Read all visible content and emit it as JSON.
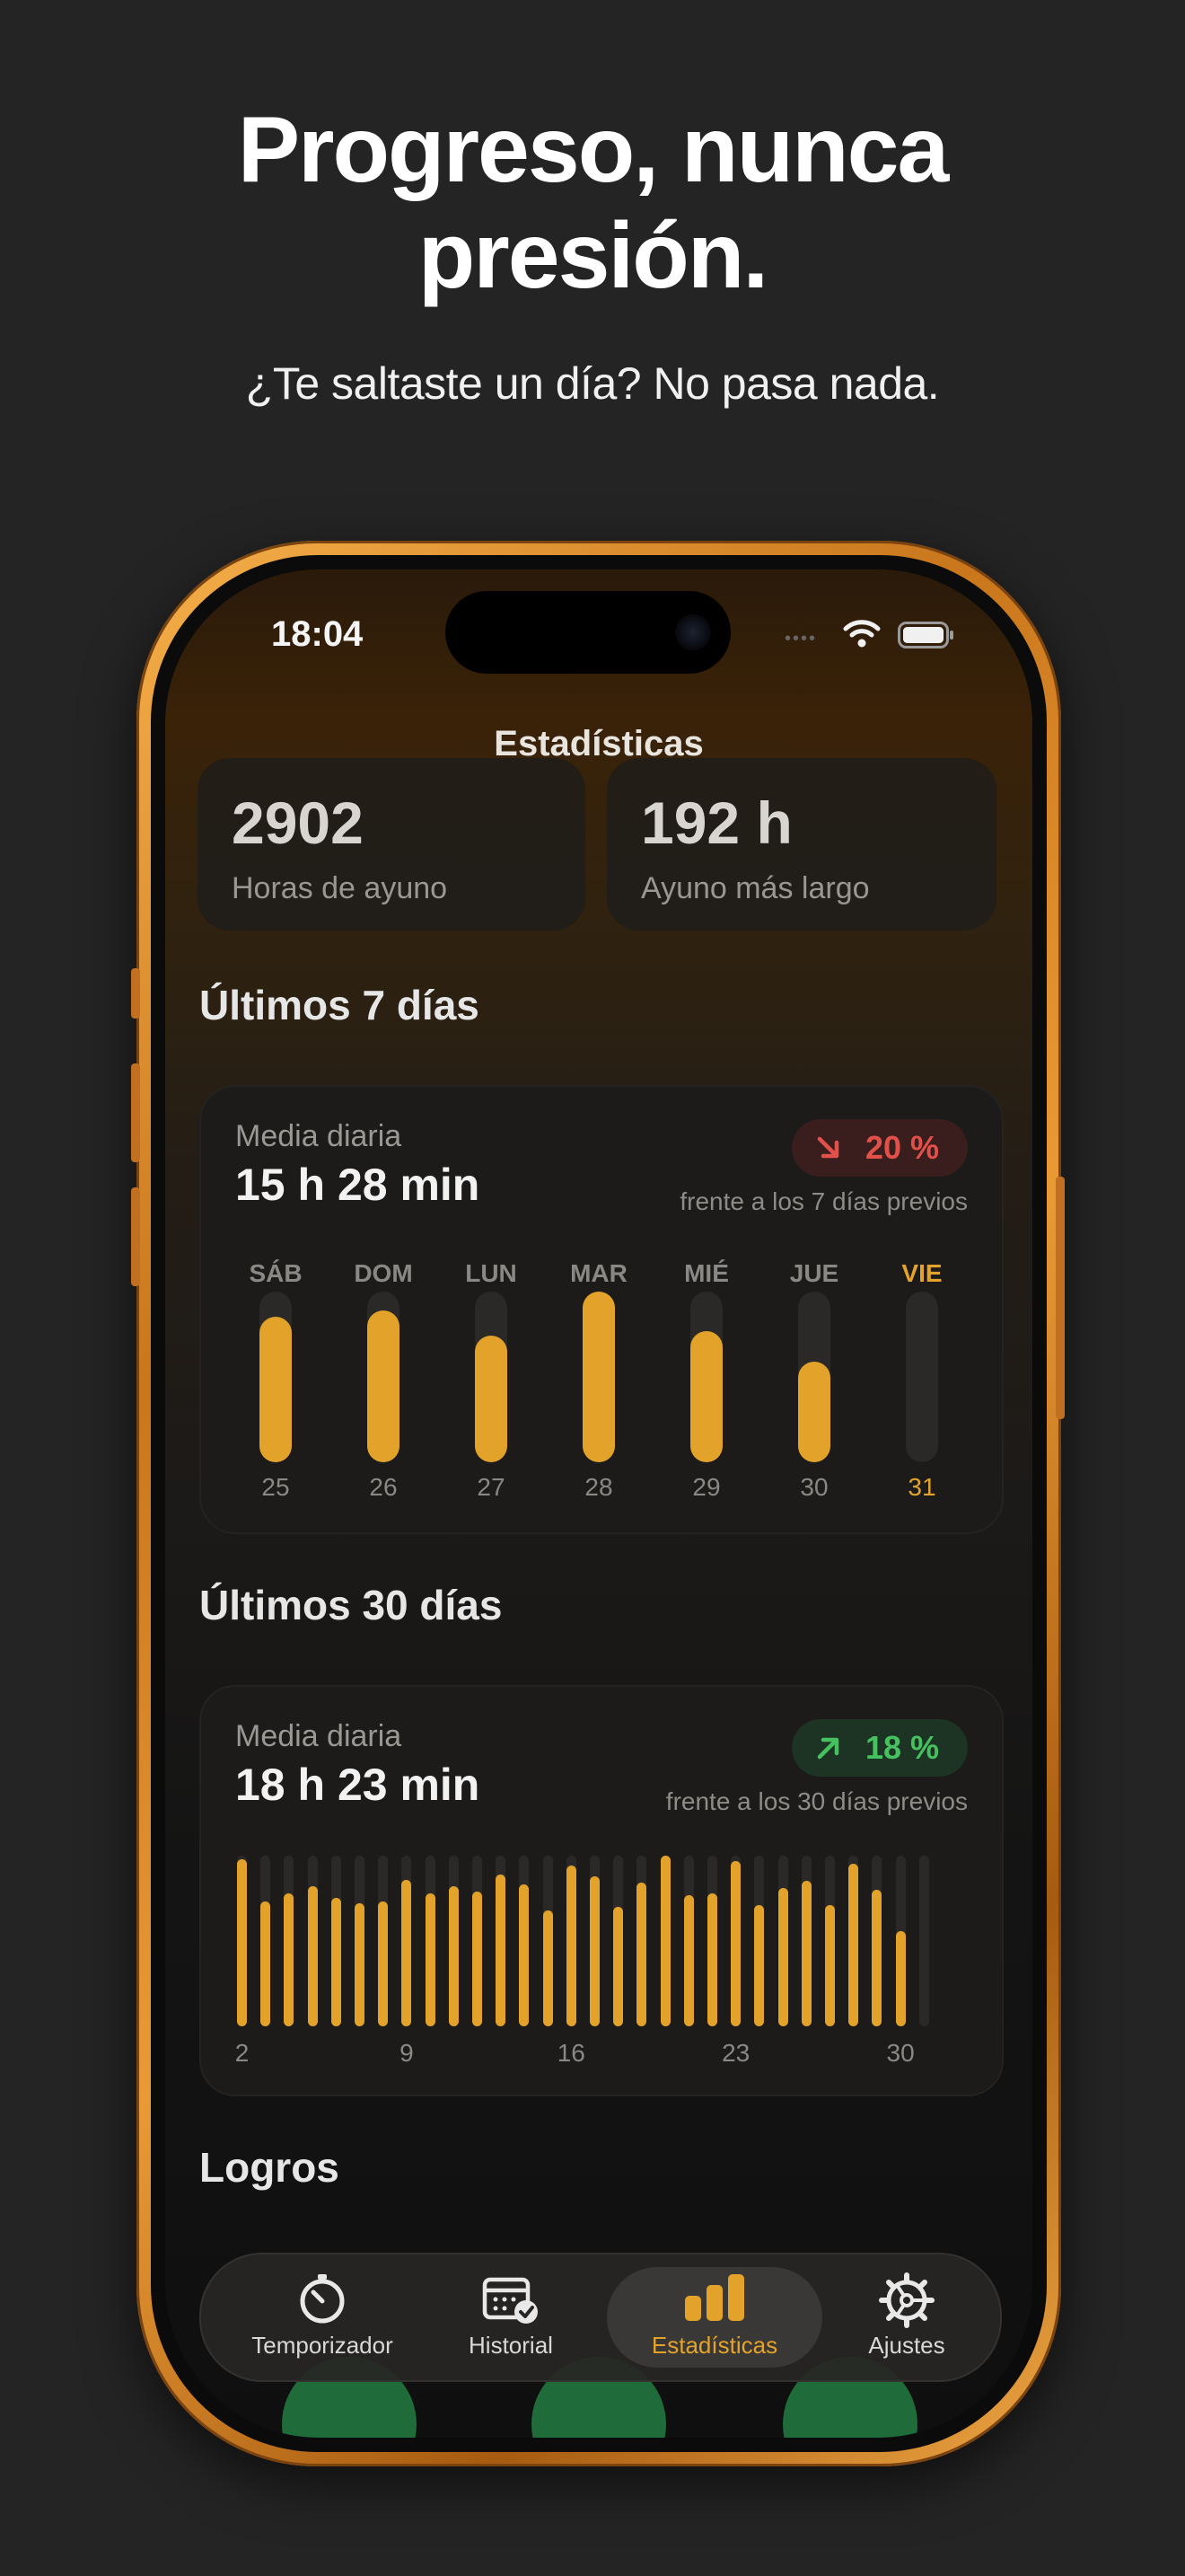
{
  "promo": {
    "headline_line1": "Progreso, nunca",
    "headline_line2": "presión.",
    "subhead": "¿Te saltaste un día? No pasa nada."
  },
  "status_bar": {
    "time": "18:04"
  },
  "nav": {
    "title": "Estadísticas"
  },
  "stats": [
    {
      "value": "2902",
      "label": "Horas de ayuno"
    },
    {
      "value": "192 h",
      "label": "Ayuno más largo"
    }
  ],
  "week": {
    "title": "Últimos 7 días",
    "sub": "Media diaria",
    "average": "15 h 28 min",
    "badge": "20 %",
    "trend": "down",
    "compare": "frente a los 7 días previos",
    "days": [
      "SÁB",
      "DOM",
      "LUN",
      "MAR",
      "MIÉ",
      "JUE",
      "VIE"
    ],
    "dates": [
      "25",
      "26",
      "27",
      "28",
      "29",
      "30",
      "31"
    ],
    "fill_fractions": [
      0.85,
      0.89,
      0.74,
      1.0,
      0.77,
      0.59,
      0.0
    ],
    "today_index": 6
  },
  "month": {
    "title": "Últimos 30 días",
    "sub": "Media diaria",
    "average": "18 h 23 min",
    "badge": "18 %",
    "trend": "up",
    "compare": "frente a los 30 días previos",
    "axis_labels": [
      "2",
      "9",
      "16",
      "23",
      "30"
    ],
    "fill_fractions": [
      0.98,
      0.73,
      0.78,
      0.82,
      0.75,
      0.72,
      0.73,
      0.86,
      0.78,
      0.82,
      0.79,
      0.89,
      0.83,
      0.68,
      0.94,
      0.88,
      0.7,
      0.84,
      1.0,
      0.77,
      0.78,
      0.97,
      0.71,
      0.81,
      0.85,
      0.71,
      0.95,
      0.8,
      0.56,
      0.0
    ]
  },
  "achievements": {
    "title": "Logros"
  },
  "tabs": [
    {
      "label": "Temporizador",
      "icon": "timer-icon"
    },
    {
      "label": "Historial",
      "icon": "calendar-check-icon"
    },
    {
      "label": "Estadísticas",
      "icon": "bar-chart-icon"
    },
    {
      "label": "Ajustes",
      "icon": "gear-icon"
    }
  ],
  "colors": {
    "accent": "#e3a32a",
    "down": "#e2504a",
    "up": "#46c15f",
    "frame": "#e99a35"
  }
}
